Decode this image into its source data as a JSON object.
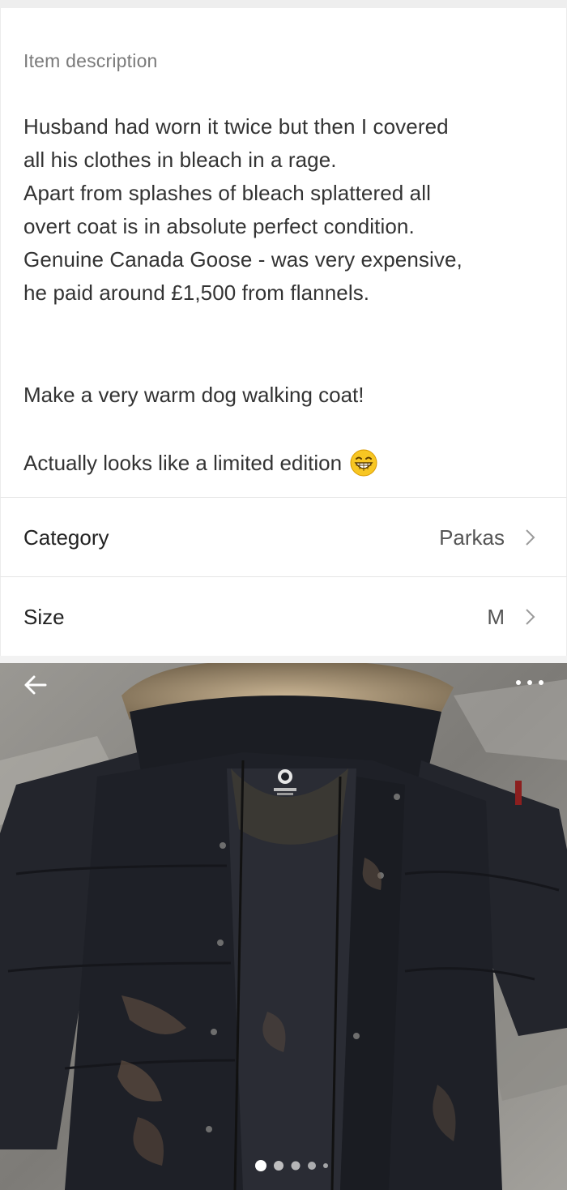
{
  "description": {
    "label": "Item description",
    "lines": [
      "Husband had worn it twice but then I covered",
      "all his clothes in bleach in a rage.",
      "Apart from splashes of bleach splattered all",
      "overt coat is in absolute perfect condition.",
      "Genuine Canada Goose - was very expensive,",
      "he paid around £1,500 from flannels."
    ],
    "extra1": "Make a very warm dog walking coat!",
    "extra2": "Actually looks like a limited edition",
    "emoji_icon": "grinning-face-emoji"
  },
  "rows": [
    {
      "label": "Category",
      "value": "Parkas",
      "icon": "chevron-right-icon"
    },
    {
      "label": "Size",
      "value": "M",
      "icon": "chevron-right-icon"
    }
  ],
  "photo": {
    "icons": {
      "back": "arrow-left-icon",
      "more": "more-dots-icon"
    },
    "carousel": {
      "count": 5,
      "active_index": 0
    }
  },
  "colors": {
    "text": "#333333",
    "muted": "#7a7a7a",
    "divider": "#e4e4e4",
    "coat": "#1e2027"
  }
}
